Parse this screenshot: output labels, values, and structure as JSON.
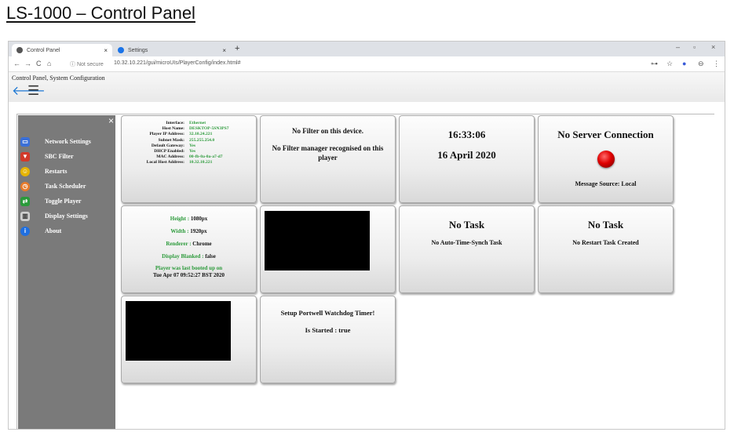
{
  "doc_title": "LS-1000 – Control Panel",
  "browser": {
    "tabs": [
      {
        "label": "Control Panel",
        "close": "×"
      },
      {
        "label": "Settings",
        "close": "×"
      }
    ],
    "new_tab": "+",
    "window_controls": {
      "minimize": "–",
      "maximize": "▫",
      "close": "×"
    },
    "nav": {
      "back": "←",
      "forward": "→",
      "reload": "C",
      "home": "⌂"
    },
    "security_label": "ⓘ Not secure",
    "url": "10.32.10.221/gui/microUIs/PlayerConfig/index.html#"
  },
  "app": {
    "breadcrumb": "Control Panel, System Configuration",
    "back_icon": "🡐",
    "menu_icon": "☰"
  },
  "sidebar": {
    "close": "×",
    "items": [
      {
        "label": "Network Settings",
        "icon": "network-icon",
        "color": "#3a6fd8"
      },
      {
        "label": "SBC Filter",
        "icon": "filter-icon",
        "color": "#d23a2a"
      },
      {
        "label": "Restarts",
        "icon": "restart-icon",
        "color": "#e6b400"
      },
      {
        "label": "Task Scheduler",
        "icon": "scheduler-icon",
        "color": "#e87b2a"
      },
      {
        "label": "Toggle Player",
        "icon": "toggle-icon",
        "color": "#2a9a3a"
      },
      {
        "label": "Display Settings",
        "icon": "display-icon",
        "color": "#cfcfcf"
      },
      {
        "label": "About",
        "icon": "info-icon",
        "color": "#1f6fe0"
      }
    ]
  },
  "tiles": {
    "network": {
      "rows": [
        {
          "k": "Interface:",
          "v": "Ethernet"
        },
        {
          "k": "Host Name:",
          "v": "DESKTOP-5SN3PS7"
        },
        {
          "k": "Player IP Address:",
          "v": "32.10.24.221"
        },
        {
          "k": "Subnet Mask:",
          "v": "255.255.254.0"
        },
        {
          "k": "Default Gateway:",
          "v": "Yes"
        },
        {
          "k": "DHCP Enabled:",
          "v": "Yes"
        },
        {
          "k": "MAC Address:",
          "v": "00-fb-0a-0a-a7-d7"
        },
        {
          "k": "Local Host Address:",
          "v": "10.32.10.221"
        }
      ]
    },
    "filter": {
      "title": "No Filter on this device.",
      "message": "No Filter manager recognised on this player"
    },
    "clock": {
      "time": "16:33:06",
      "date": "16 April 2020"
    },
    "server": {
      "title": "No Server Connection",
      "message": "Message Source: Local",
      "status_color": "#e00000"
    },
    "display": {
      "height_label": "Height :",
      "height_value": "1080px",
      "width_label": "Width :",
      "width_value": "1920px",
      "renderer_label": "Renderer :",
      "renderer_value": "Chrome",
      "blanked_label": "Display Blanked :",
      "blanked_value": "false",
      "booted_label": "Player was last booted up on",
      "booted_value": "Tue Apr 07 09:52:27 BST 2020"
    },
    "task_sync": {
      "title": "No Task",
      "message": "No Auto-Time-Synch Task"
    },
    "task_restart": {
      "title": "No Task",
      "message": "No Restart Task Created"
    },
    "watchdog": {
      "title": "Setup Portwell Watchdog Timer!",
      "status": "Is Started : true"
    }
  }
}
